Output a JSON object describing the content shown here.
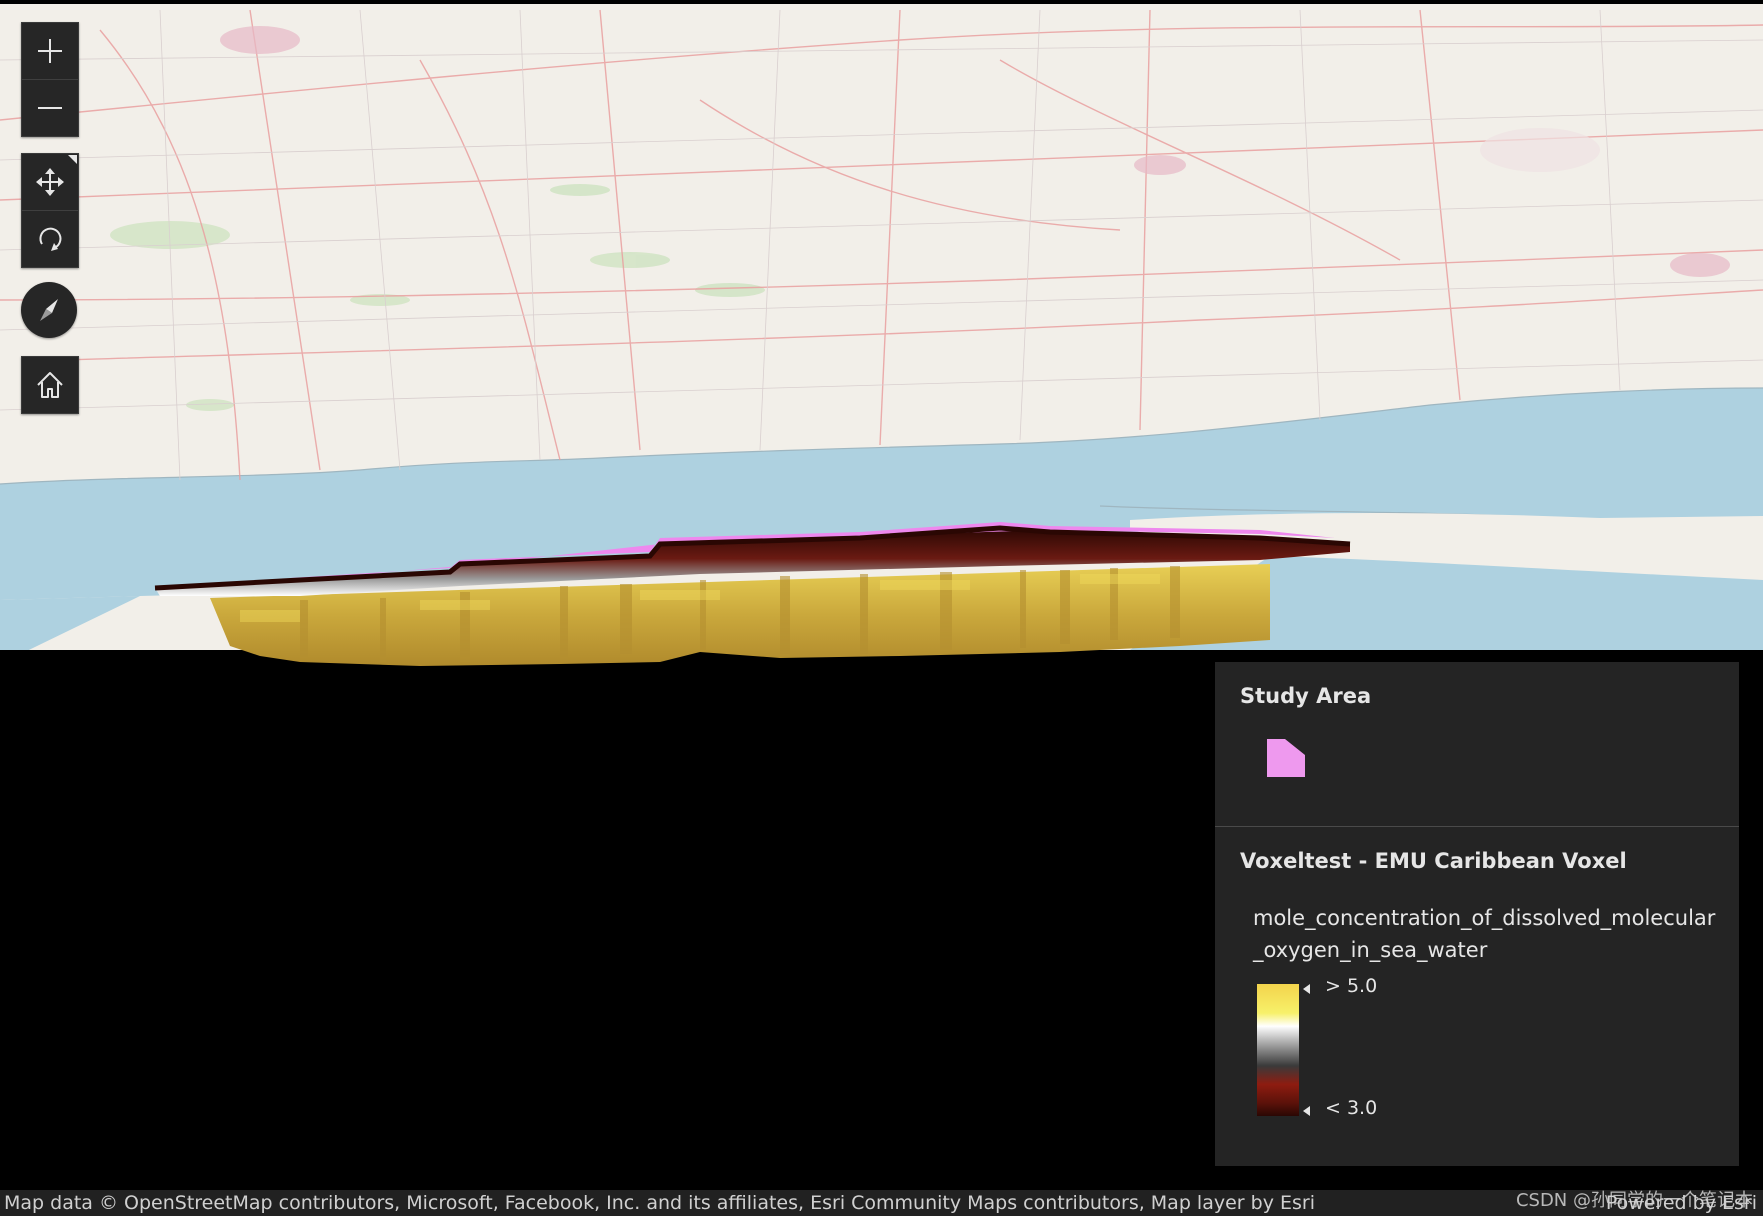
{
  "map": {
    "zoom_in_icon": "plus-icon",
    "zoom_out_icon": "minus-icon",
    "pan_icon": "move-arrows-icon",
    "rotate_icon": "rotate-icon",
    "compass_icon": "compass-needle-icon",
    "home_icon": "home-icon",
    "colors": {
      "land": "#f2efe9",
      "water": "#aed1e0",
      "roads": "#e9a0a0",
      "voxel_yellow": "#c9a93b",
      "voxel_top": "#ee88ee",
      "voxel_edge": "#6a1a12",
      "background": "#000000"
    }
  },
  "legend": {
    "study_area": {
      "title": "Study Area",
      "swatch_color": "#ee99ee"
    },
    "voxel": {
      "title": "Voxeltest - EMU Caribbean Voxel",
      "field": "mole_concentration_of_dissolved_molecular_oxygen_in_sea_water",
      "high_label": "> 5.0",
      "low_label": "< 3.0"
    }
  },
  "attribution": {
    "text": "Map data © OpenStreetMap contributors, Microsoft, Facebook, Inc. and its affiliates, Esri Community Maps contributors, Map layer by Esri",
    "powered": "Powered by Esri"
  },
  "watermark": "CSDN @孙同学的一个笔记本"
}
